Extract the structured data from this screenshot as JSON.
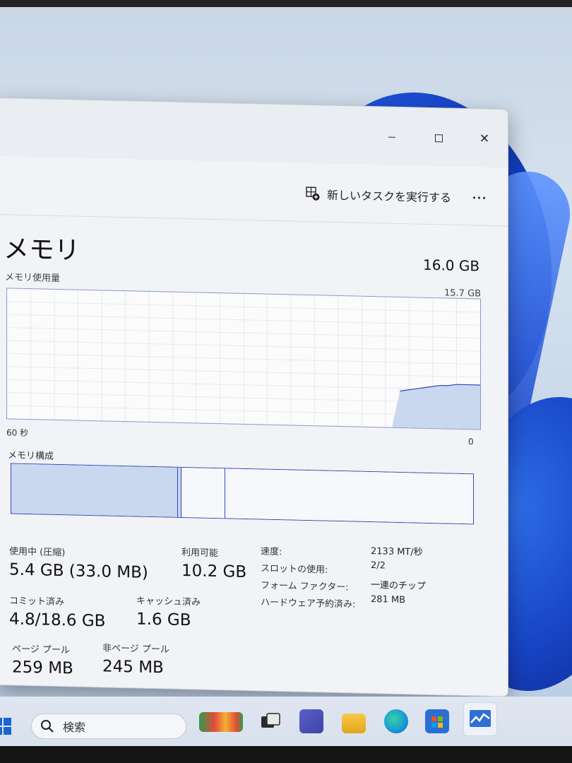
{
  "window": {
    "run_new_task_label": "新しいタスクを実行する"
  },
  "memory": {
    "title": "メモリ",
    "total": "16.0 GB",
    "usage_label": "メモリ使用量",
    "usage_max": "15.7 GB",
    "axis_left": "60 秒",
    "axis_right": "0",
    "composition_label": "メモリ構成",
    "usage_history_fraction": [
      0,
      0,
      0,
      0,
      0,
      0,
      0,
      0,
      0,
      0,
      0,
      0,
      0,
      0,
      0,
      0,
      0,
      0,
      0,
      0,
      0,
      0,
      0,
      0,
      0,
      0,
      0,
      0,
      0,
      0,
      0,
      0,
      0,
      0,
      0,
      0,
      0,
      0,
      0,
      0,
      0,
      0,
      0,
      0,
      0,
      0,
      0,
      0,
      0,
      0.28,
      0.29,
      0.3,
      0.31,
      0.32,
      0.33,
      0.33,
      0.34,
      0.34,
      0.34,
      0.34
    ]
  },
  "stats": {
    "in_use_label": "使用中 (圧縮)",
    "in_use_value": "5.4 GB (33.0 MB)",
    "available_label": "利用可能",
    "available_value": "10.2 GB",
    "committed_label": "コミット済み",
    "committed_value": "4.8/18.6 GB",
    "cached_label": "キャッシュ済み",
    "cached_value": "1.6 GB",
    "paged_pool_label": "ページ プール",
    "paged_pool_value": "259 MB",
    "nonpaged_pool_label": "非ページ プール",
    "nonpaged_pool_value": "245 MB"
  },
  "details": [
    {
      "key": "速度:",
      "value": "2133 MT/秒"
    },
    {
      "key": "スロットの使用:",
      "value": "2/2"
    },
    {
      "key": "フォーム ファクター:",
      "value": "一連のチップ"
    },
    {
      "key": "ハードウェア予約済み:",
      "value": "281 MB"
    }
  ],
  "taskbar": {
    "search_label": "検索"
  },
  "colors": {
    "accent": "#3146b7",
    "graph_fill": "#c9d8ef",
    "window_bg": "#f1f3f6"
  }
}
